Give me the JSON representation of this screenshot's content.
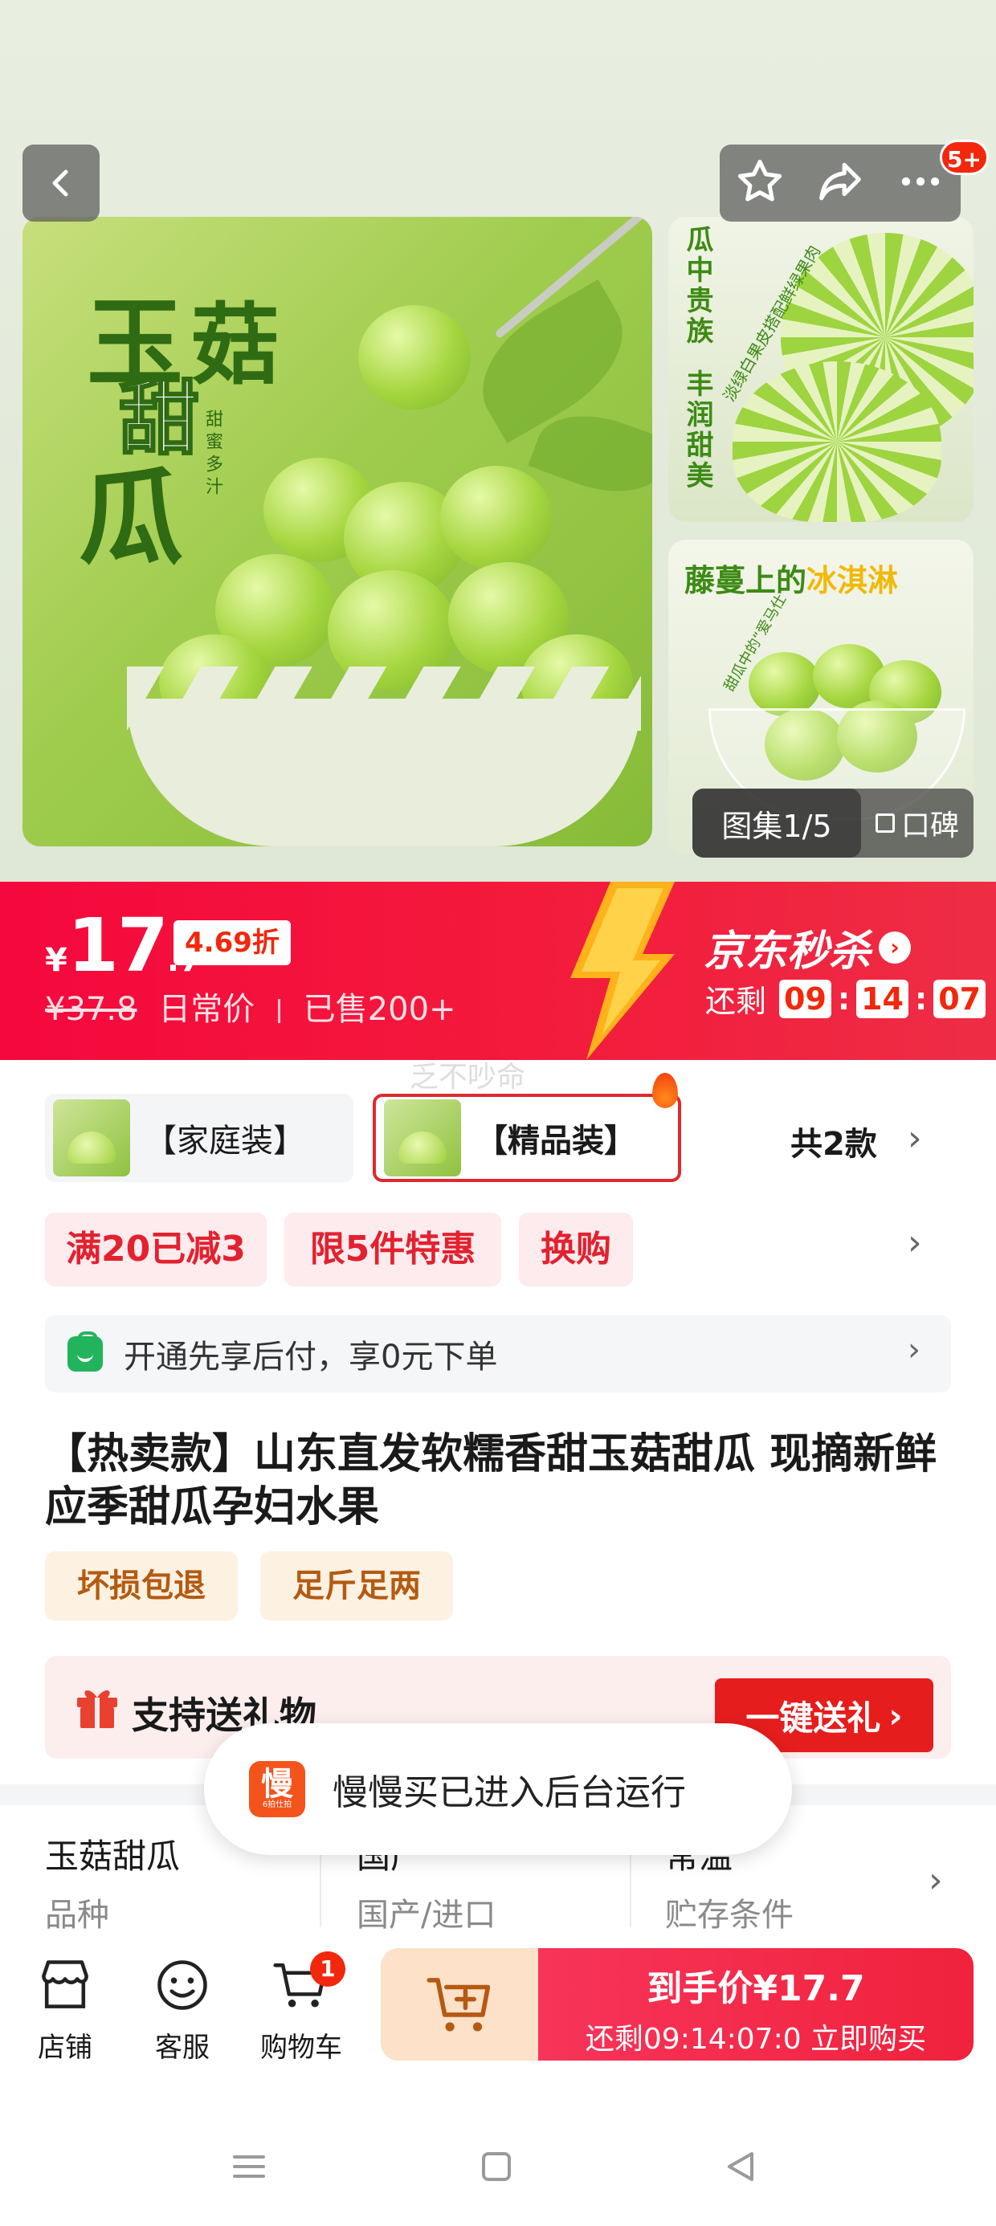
{
  "gallery": {
    "main_title_chars": [
      "玉",
      "菇",
      "甜",
      "瓜"
    ],
    "main_subtitle": "甜蜜多汁",
    "side1_vertical_1": "瓜中贵族",
    "side1_vertical_2": "丰润甜美",
    "side1_caption": "淡绿白果皮搭配鲜绿果肉",
    "side2_heading_a": "藤蔓上的",
    "side2_heading_b": "冰淇淋",
    "side2_caption": "甜瓜中的“爱马仕”",
    "more_badge": "5+",
    "gallery_label": "图集1/5",
    "reviews_label": "口碑"
  },
  "price": {
    "currency": "¥",
    "integer": "17",
    "decimal": ".7",
    "discount": "4.69折",
    "original": "¥37.8",
    "original_label": "日常价",
    "sold": "已售200+",
    "promo_brand": "京东秒杀",
    "countdown_label": "还剩",
    "countdown_h": "09",
    "countdown_m": "14",
    "countdown_s": "07"
  },
  "watermark": "乏不吵命",
  "variants": {
    "items": [
      {
        "label": "【家庭装】"
      },
      {
        "label": "【精品装】"
      }
    ],
    "count_label": "共2款"
  },
  "promos": [
    "满20已减3",
    "限5件特惠",
    "换购"
  ],
  "credit": {
    "text": "开通先享后付，享0元下单"
  },
  "product": {
    "title": "【热卖款】山东直发软糯香甜玉菇甜瓜 现摘新鲜应季甜瓜孕妇水果",
    "services": [
      "坏损包退",
      "足斤足两"
    ]
  },
  "gift": {
    "label": "支持送礼物",
    "button": "一键送礼"
  },
  "attributes": [
    {
      "value": "玉菇甜瓜",
      "key": "品种"
    },
    {
      "value": "国产",
      "key": "国产/进口"
    },
    {
      "value": "常温",
      "key": "贮存条件"
    }
  ],
  "toast": {
    "logo_char": "慢",
    "logo_sub": "6拍仕拍",
    "text": "慢慢买已进入后台运行"
  },
  "bottom_bar": {
    "shop": "店铺",
    "service": "客服",
    "cart": "购物车",
    "cart_count": "1",
    "buy_line1": "到手价¥17.7",
    "buy_line2": "还剩09:14:07:0  立即购买"
  },
  "colors": {
    "accent_red": "#f2270c",
    "banner_red": "#f5083d",
    "green": "#22b45c"
  }
}
